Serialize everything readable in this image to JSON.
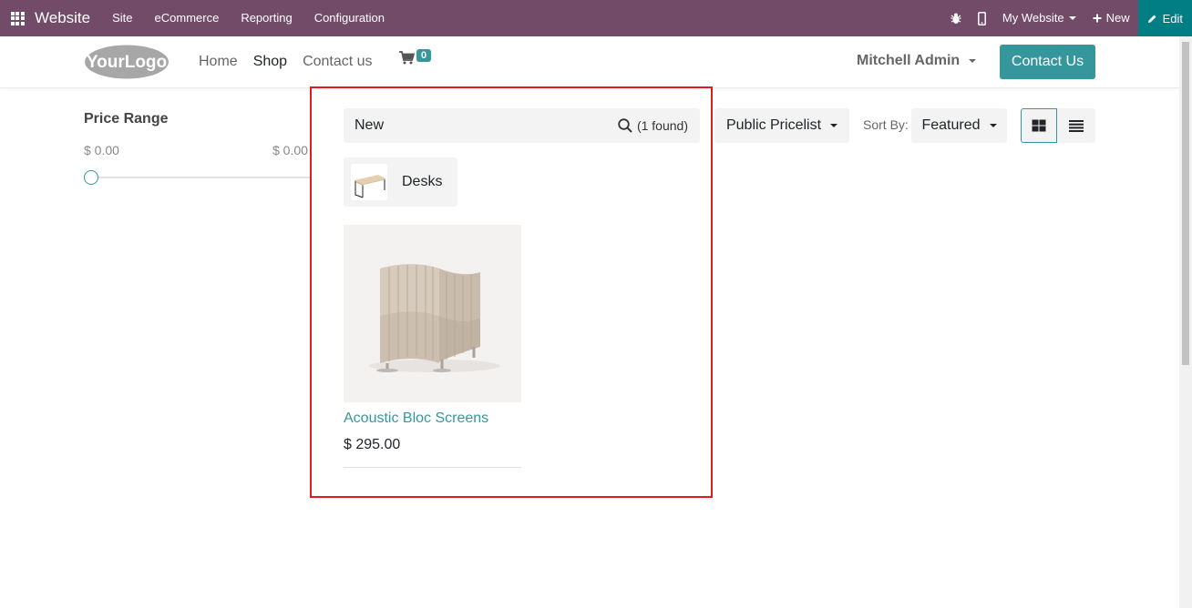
{
  "topbar": {
    "brand": "Website",
    "menu": [
      "Site",
      "eCommerce",
      "Reporting",
      "Configuration"
    ],
    "my_website": "My Website",
    "new_label": "New",
    "edit_label": "Edit"
  },
  "header": {
    "logo_text": "YourLogo",
    "nav": [
      "Home",
      "Shop",
      "Contact us"
    ],
    "cart_count": "0",
    "user": "Mitchell Admin",
    "contact_button": "Contact Us"
  },
  "sidebar": {
    "price_title": "Price Range",
    "price_min": "$ 0.00",
    "price_max": "$ 0.00"
  },
  "search": {
    "query": "New",
    "found": "(1 found)"
  },
  "results": {
    "category": "Desks",
    "product_name": "Acoustic Bloc Screens",
    "product_price": "$ 295.00"
  },
  "toolbar": {
    "pricelist": "Public Pricelist",
    "sortby_label": "Sort By:",
    "sortby_value": "Featured"
  },
  "colors": {
    "admin_bar": "#714b67",
    "accent": "#35979c",
    "highlight": "#e01b1b",
    "edit": "#017e84"
  }
}
